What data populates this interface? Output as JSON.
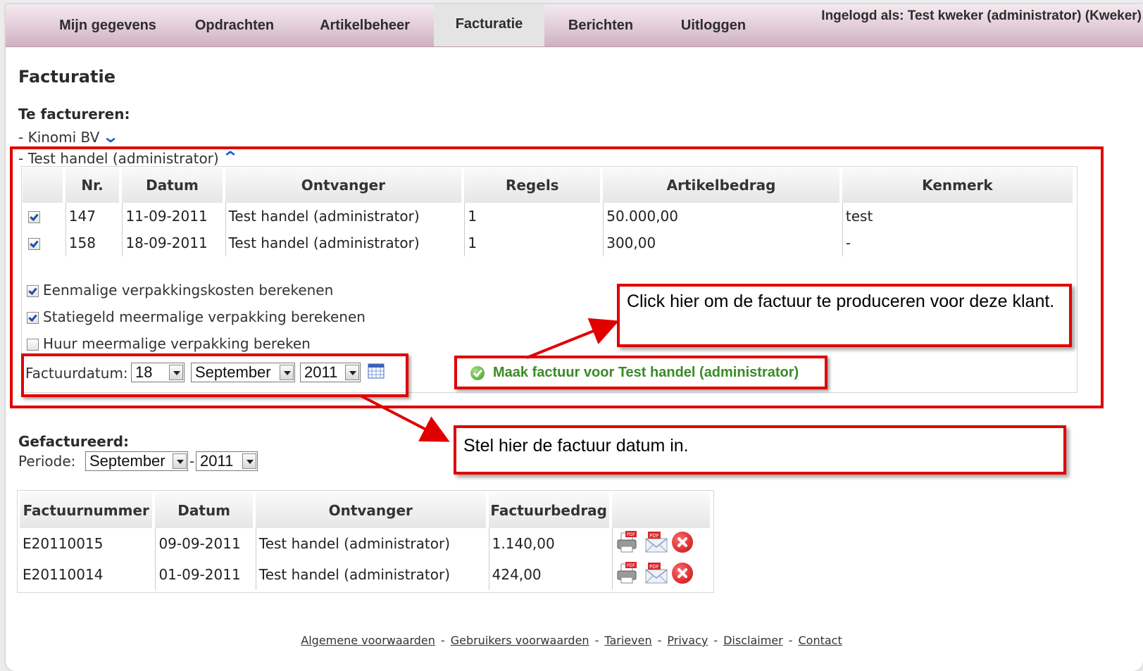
{
  "nav": {
    "items": [
      {
        "label": "Mijn gegevens"
      },
      {
        "label": "Opdrachten"
      },
      {
        "label": "Artikelbeheer"
      },
      {
        "label": "Facturatie"
      },
      {
        "label": "Berichten"
      },
      {
        "label": "Uitloggen"
      }
    ],
    "active": "Facturatie",
    "login_info": "Ingelogd als: Test kweker (administrator) (Kweker)"
  },
  "page_title": "Facturatie",
  "to_invoice": {
    "heading": "Te factureren:",
    "customers": [
      {
        "label": "- Kinomi BV",
        "expanded": false
      },
      {
        "label": "- Test handel (administrator)",
        "expanded": true
      }
    ],
    "table": {
      "headers": [
        "",
        "Nr.",
        "Datum",
        "Ontvanger",
        "Regels",
        "Artikelbedrag",
        "Kenmerk"
      ],
      "rows": [
        {
          "checked": true,
          "nr": "147",
          "datum": "11-09-2011",
          "ontvanger": "Test handel (administrator)",
          "regels": "1",
          "bedrag": "50.000,00",
          "kenmerk": "test"
        },
        {
          "checked": true,
          "nr": "158",
          "datum": "18-09-2011",
          "ontvanger": "Test handel (administrator)",
          "regels": "1",
          "bedrag": "300,00",
          "kenmerk": "-"
        }
      ]
    },
    "options": [
      {
        "label": "Eenmalige verpakkingskosten berekenen",
        "checked": true
      },
      {
        "label": "Statiegeld meermalige verpakking berekenen",
        "checked": true
      },
      {
        "label": "Huur meermalige verpakking bereken",
        "checked": false
      }
    ],
    "invoice_date": {
      "label": "Factuurdatum:",
      "day": "18",
      "month": "September",
      "year": "2011"
    },
    "make_button": "Maak factuur voor Test handel (administrator)"
  },
  "callouts": {
    "make_invoice": "Click hier om de factuur te produceren voor deze klant.",
    "set_date": "Stel hier de factuur datum in."
  },
  "invoiced": {
    "heading": "Gefactureerd:",
    "period_label": "Periode:",
    "period_month": "September",
    "period_separator": "-",
    "period_year": "2011",
    "table": {
      "headers": [
        "Factuurnummer",
        "Datum",
        "Ontvanger",
        "Factuurbedrag",
        ""
      ],
      "rows": [
        {
          "nummer": "E20110015",
          "datum": "09-09-2011",
          "ontvanger": "Test handel (administrator)",
          "bedrag": "1.140,00"
        },
        {
          "nummer": "E20110014",
          "datum": "01-09-2011",
          "ontvanger": "Test handel (administrator)",
          "bedrag": "424,00"
        }
      ]
    }
  },
  "footer": {
    "links": [
      "Algemene voorwaarden",
      "Gebruikers voorwaarden",
      "Tarieven",
      "Privacy",
      "Disclaimer",
      "Contact"
    ],
    "separator": "-"
  },
  "colors": {
    "nav_gradient_end": "#cfb1c2",
    "annotation_red": "#e00000",
    "action_green": "#3a8a26",
    "chevron_blue": "#1d5fc4"
  }
}
